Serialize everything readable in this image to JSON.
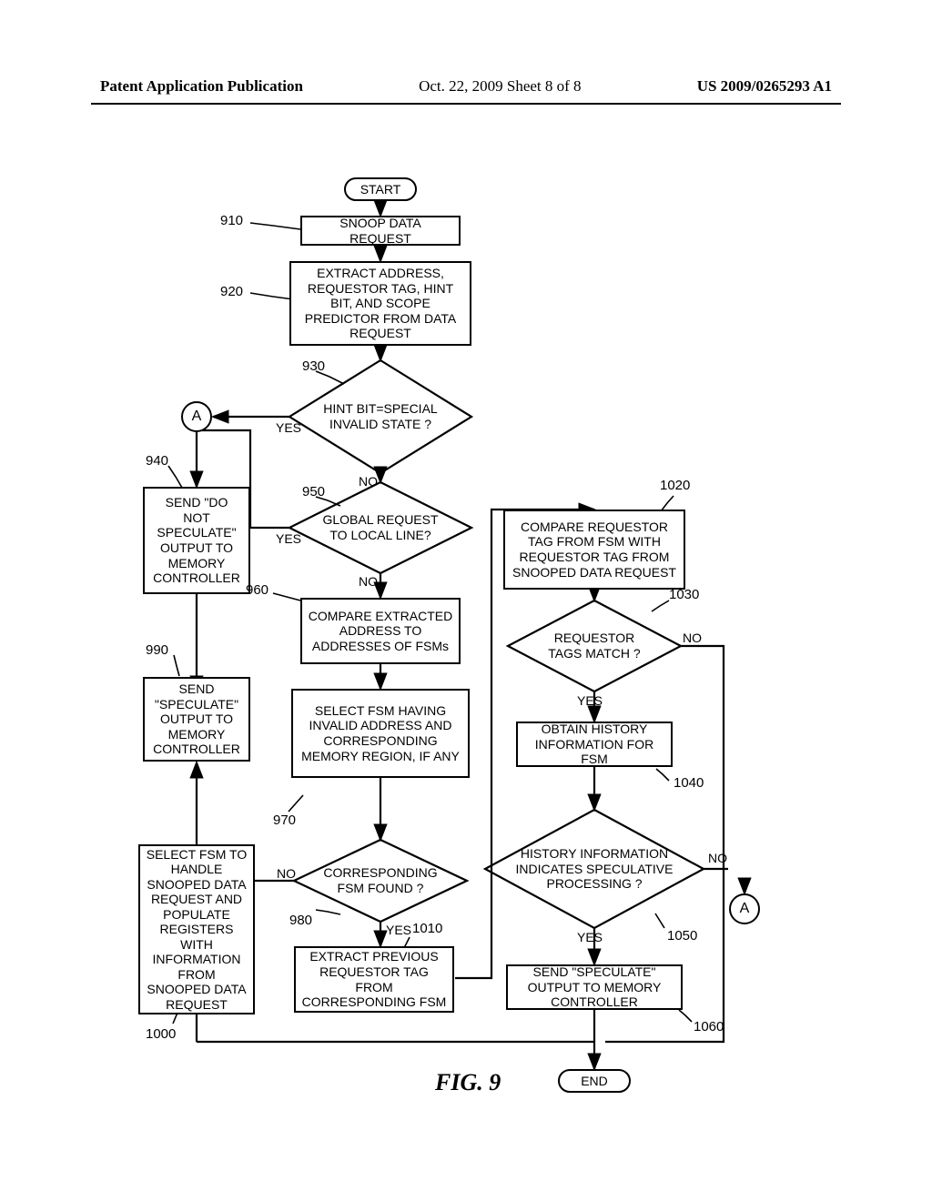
{
  "header": {
    "left": "Patent Application Publication",
    "mid": "Oct. 22, 2009  Sheet 8 of 8",
    "right": "US 2009/0265293 A1"
  },
  "figure": {
    "caption": "FIG. 9"
  },
  "terminators": {
    "start": "START",
    "end": "END"
  },
  "connectors": {
    "A1": "A",
    "A2": "A"
  },
  "boxes": {
    "b910": "SNOOP DATA REQUEST",
    "b920": "EXTRACT ADDRESS, REQUESTOR TAG, HINT BIT, AND SCOPE PREDICTOR FROM DATA REQUEST",
    "b940": "SEND \"DO NOT SPECULATE\" OUTPUT TO MEMORY CONTROLLER",
    "b960": "COMPARE EXTRACTED ADDRESS TO ADDRESSES OF FSMs",
    "b970": "SELECT FSM HAVING INVALID ADDRESS AND CORRESPONDING MEMORY REGION, IF ANY",
    "b990": "SEND \"SPECULATE\" OUTPUT TO MEMORY CONTROLLER",
    "b1000": "SELECT FSM TO HANDLE SNOOPED DATA REQUEST AND POPULATE REGISTERS WITH INFORMATION FROM SNOOPED DATA REQUEST",
    "b1010": "EXTRACT PREVIOUS REQUESTOR TAG FROM CORRESPONDING FSM",
    "b1020": "COMPARE REQUESTOR TAG FROM FSM WITH REQUESTOR TAG FROM SNOOPED DATA REQUEST",
    "b1040": "OBTAIN HISTORY INFORMATION FOR FSM",
    "b1060": "SEND \"SPECULATE\" OUTPUT TO MEMORY CONTROLLER"
  },
  "diamonds": {
    "d930": "HINT BIT=SPECIAL INVALID STATE ?",
    "d950": "GLOBAL REQUEST TO LOCAL LINE?",
    "d980": "CORRESPONDING FSM FOUND ?",
    "d1030": "REQUESTOR TAGS MATCH ?",
    "d1050": "HISTORY INFORMATION INDICATES SPECULATIVE PROCESSING ?"
  },
  "refs": {
    "r910": "910",
    "r920": "920",
    "r930": "930",
    "r940": "940",
    "r950": "950",
    "r960": "960",
    "r970": "970",
    "r980": "980",
    "r990": "990",
    "r1000": "1000",
    "r1010": "1010",
    "r1020": "1020",
    "r1030": "1030",
    "r1040": "1040",
    "r1050": "1050",
    "r1060": "1060"
  },
  "branches": {
    "yes": "YES",
    "no": "NO"
  }
}
